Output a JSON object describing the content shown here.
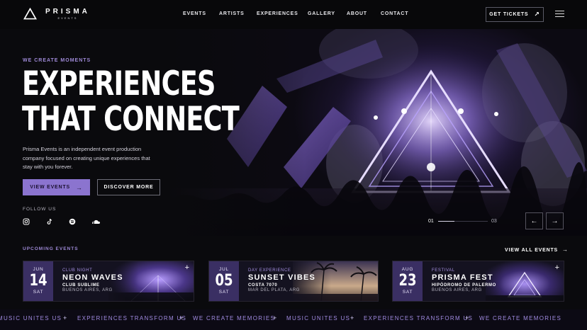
{
  "brand": {
    "name": "PRISMA",
    "sub": "EVENTS"
  },
  "nav": {
    "links": [
      "EVENTS",
      "ARTISTS",
      "EXPERIENCES",
      "GALLERY",
      "ABOUT",
      "CONTACT"
    ],
    "cta_label": "GET TICKETS",
    "cta_icon": "arrow-up-right-icon",
    "menu_icon": "hamburger-menu-icon"
  },
  "hero": {
    "eyebrow": "WE CREATE MOMENTS",
    "headline_line1": "EXPERIENCES",
    "headline_line2": "THAT CONNECT",
    "description": "Prisma Events is an independent event production company focused on creating unique experiences that stay with you forever.",
    "primary_button": "VIEW EVENTS",
    "secondary_button": "DISCOVER MORE",
    "follow_label": "FOLLOW US",
    "social_icons": [
      "instagram-icon",
      "tiktok-icon",
      "spotify-icon",
      "soundcloud-icon"
    ],
    "slider": {
      "current": "01",
      "total": "03",
      "progress": 0.33
    }
  },
  "upcoming": {
    "title": "UPCOMING EVENTS",
    "view_all": "VIEW ALL EVENTS",
    "events": [
      {
        "month": "JUN",
        "day": "14",
        "weekday": "SAT",
        "category": "CLUB NIGHT",
        "name": "NEON WAVES",
        "venue": "CLUB SUBLIME",
        "city": "BUENOS AIRES, ARG"
      },
      {
        "month": "JUL",
        "day": "05",
        "weekday": "SAT",
        "category": "DAY EXPERIENCE",
        "name": "SUNSET VIBES",
        "venue": "COSTA 7070",
        "city": "MAR DEL PLATA, ARG"
      },
      {
        "month": "AUG",
        "day": "23",
        "weekday": "SAT",
        "category": "FESTIVAL",
        "name": "PRISMA FEST",
        "venue": "HIPÓDROMO DE PALERMO",
        "city": "BUENOS AIRES, ARG"
      }
    ]
  },
  "marquee": [
    "MUSIC UNITES US",
    "EXPERIENCES TRANSFORM US",
    "WE CREATE MEMORIES",
    "MUSIC UNITES US",
    "EXPERIENCES TRANSFORM US",
    "WE CREATE MEMORIES"
  ],
  "colors": {
    "accent": "#8b74cf",
    "accent_text": "#9f8ad8",
    "background": "#0a0a0d",
    "date_block": "#3a2f63"
  }
}
